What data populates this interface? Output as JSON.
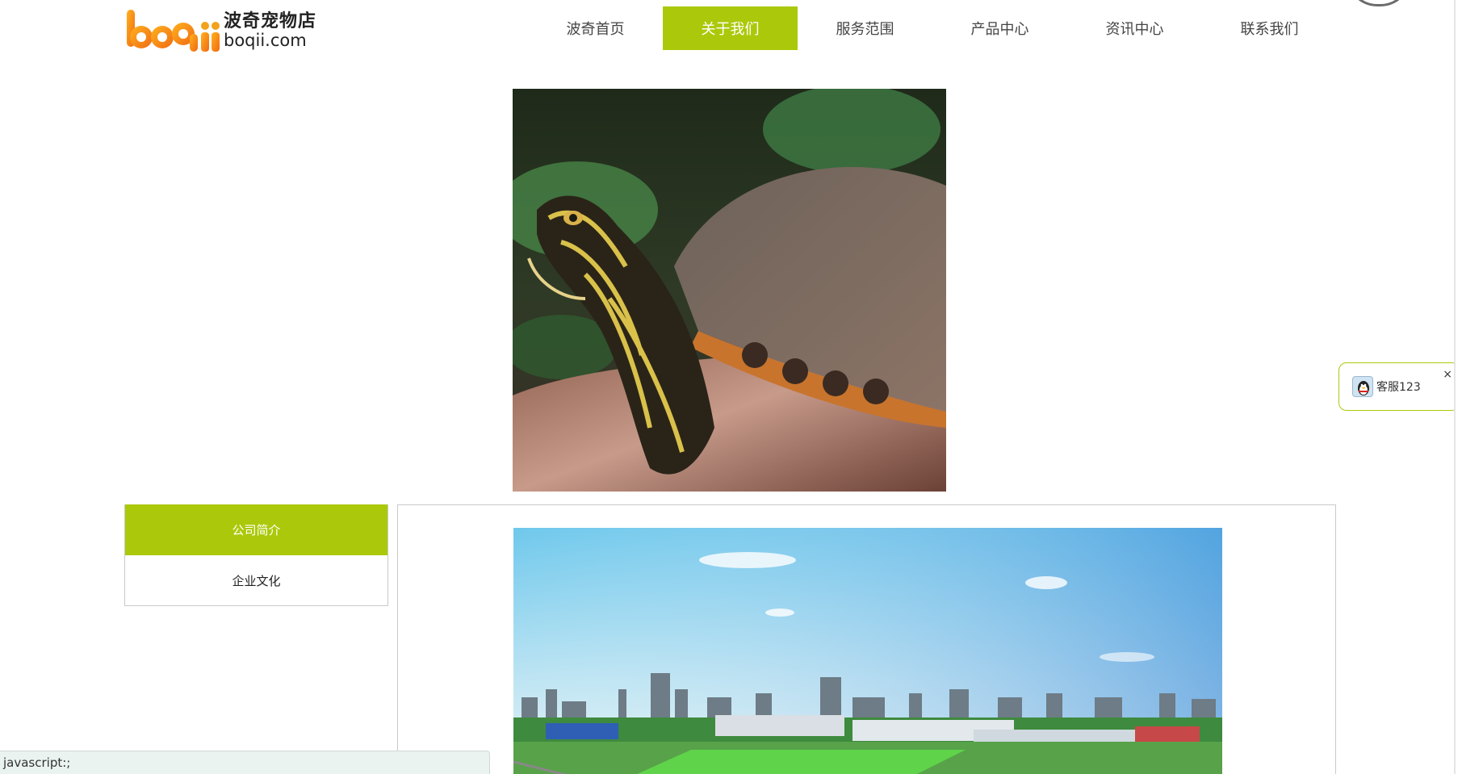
{
  "header": {
    "logo_cn": "波奇宠物店",
    "logo_en": "boqii.com",
    "nav": [
      {
        "label": "波奇首页",
        "active": false
      },
      {
        "label": "关于我们",
        "active": true
      },
      {
        "label": "服务范围",
        "active": false
      },
      {
        "label": "产品中心",
        "active": false
      },
      {
        "label": "资讯中心",
        "active": false
      },
      {
        "label": "联系我们",
        "active": false
      }
    ]
  },
  "side_menu": {
    "items": [
      {
        "label": "公司简介",
        "active": true
      },
      {
        "label": "企业文化",
        "active": false
      }
    ]
  },
  "service_widget": {
    "label": "客服123",
    "close": "×",
    "icon": "qq-penguin-icon"
  },
  "status_bar": {
    "text": "javascript:;"
  },
  "colors": {
    "accent": "#abc90a",
    "border": "#c9c9c9",
    "status_bg": "#eaf3ef"
  }
}
